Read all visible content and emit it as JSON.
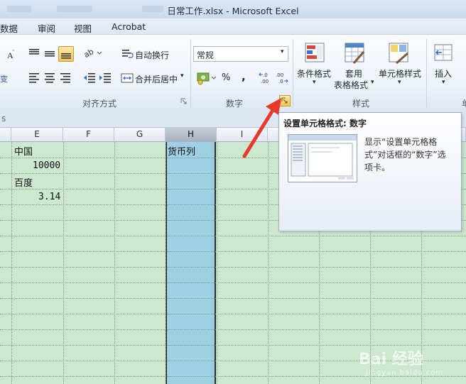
{
  "window": {
    "title": "日常工作.xlsx - Microsoft Excel"
  },
  "menu": {
    "tabs": [
      "数据",
      "审阅",
      "视图",
      "Acrobat"
    ]
  },
  "ribbon": {
    "alignment": {
      "wrap_text": "自动换行",
      "merge_center": "合并后居中",
      "group_label": "对齐方式"
    },
    "number": {
      "format_value": "常规",
      "percent": "%",
      "comma": ",",
      "group_label": "数字",
      "launcher_icon": "dialog-launcher-icon"
    },
    "styles": {
      "conditional": "条件格式",
      "table_format": "套用\n表格格式",
      "cell_styles": "单元格样式",
      "group_label": "样式"
    },
    "cells": {
      "insert": "插入"
    },
    "accent": "#e8b33c"
  },
  "grid": {
    "columns": [
      "E",
      "F",
      "G",
      "H",
      "I"
    ],
    "selected_column": "H",
    "cells": {
      "e1": "中国",
      "e2": "10000",
      "e3": "百度",
      "e4": "3.14",
      "h1": "货币列"
    },
    "selection_color": "#9fcfe3",
    "background": "#cce8cf"
  },
  "tooltip": {
    "title": "设置单元格格式: 数字",
    "description": "显示“设置单元格格式”对话框的“数字”选项卡。"
  },
  "watermark": {
    "brand": "Bai 经验",
    "sub": "jingyan.baidu.com"
  }
}
